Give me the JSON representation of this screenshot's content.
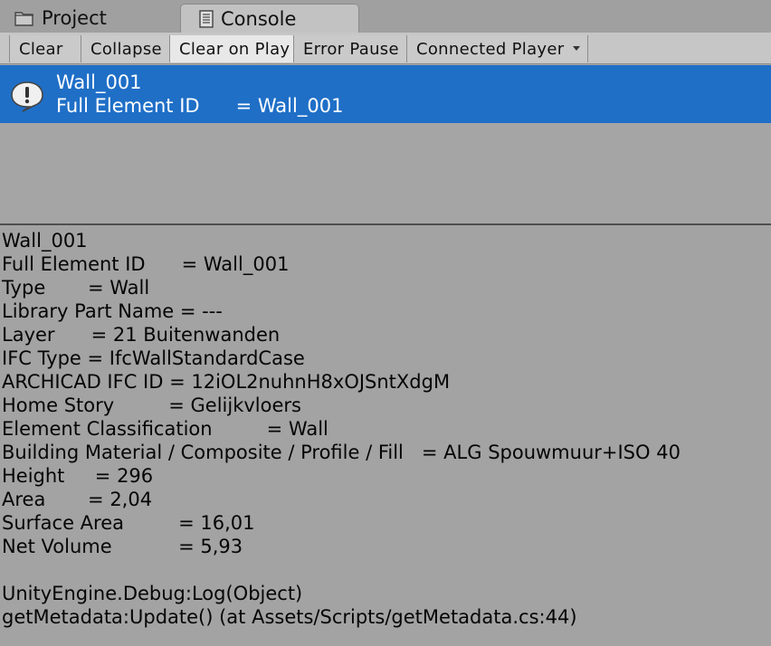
{
  "tabs": {
    "project_label": "Project",
    "console_label": "Console"
  },
  "toolbar": {
    "clear": "Clear",
    "collapse": "Collapse",
    "clear_on_play": "Clear on Play",
    "error_pause": "Error Pause",
    "connected_player": "Connected Player"
  },
  "selected_message": {
    "line1": "Wall_001",
    "line2": "Full Element ID      = Wall_001"
  },
  "details": {
    "lines": [
      "Wall_001",
      "Full Element ID      = Wall_001",
      "Type       = Wall",
      "Library Part Name = ---",
      "Layer      = 21 Buitenwanden",
      "IFC Type = IfcWallStandardCase",
      "ARCHICAD IFC ID = 12iOL2nuhnH8xOJSntXdgM",
      "Home Story         = Gelijkvloers",
      "Element Classification         = Wall",
      "Building Material / Composite / Profile / Fill   = ALG Spouwmuur+ISO 40",
      "Height     = 296",
      "Area       = 2,04",
      "Surface Area         = 16,01",
      "Net Volume           = 5,93",
      "",
      "UnityEngine.Debug:Log(Object)",
      "getMetadata:Update() (at Assets/Scripts/getMetadata.cs:44)"
    ]
  },
  "colors": {
    "selection": "#1f6fc7",
    "background": "#a3a3a3"
  }
}
